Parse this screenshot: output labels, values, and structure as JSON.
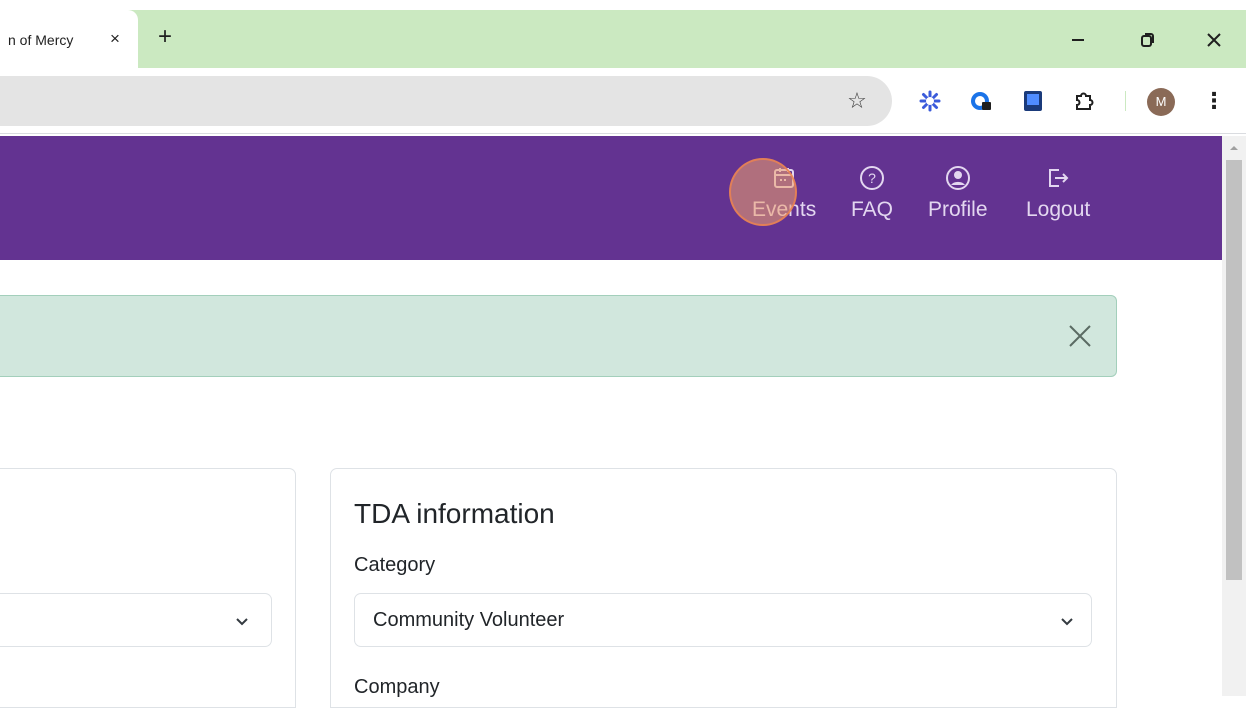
{
  "browser": {
    "tab_title": "n of Mercy",
    "tab_close": "×",
    "new_tab": "+",
    "avatar_initial": "M",
    "menu_glyph": "⋮",
    "star_glyph": "☆"
  },
  "nav": {
    "items": [
      {
        "label": "Events",
        "icon": "calendar-icon"
      },
      {
        "label": "FAQ",
        "icon": "question-circle-icon"
      },
      {
        "label": "Profile",
        "icon": "person-circle-icon"
      },
      {
        "label": "Logout",
        "icon": "logout-icon"
      }
    ]
  },
  "tda_card": {
    "title": "TDA information",
    "category_label": "Category",
    "category_value": "Community Volunteer",
    "company_label": "Company"
  },
  "left_card": {
    "select_value": ""
  },
  "colors": {
    "navbar": "#633391",
    "tabbar": "#cbe9c1",
    "alert_bg": "#d1e7dd"
  }
}
